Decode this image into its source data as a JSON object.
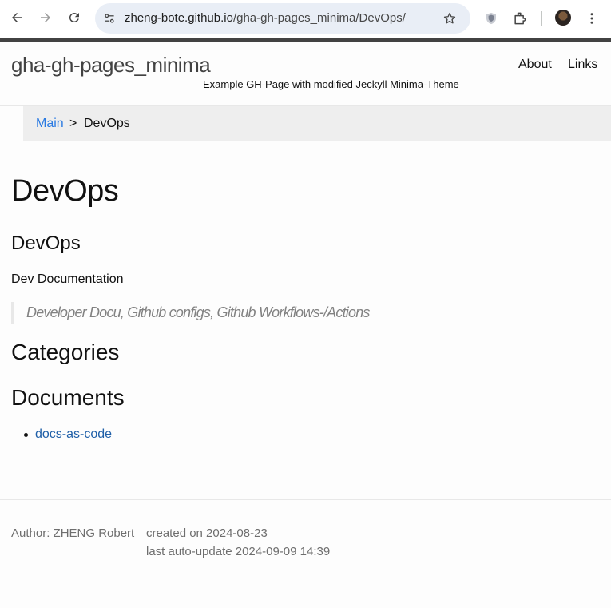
{
  "browser": {
    "url_host": "zheng-bote.github.io",
    "url_path": "/gha-gh-pages_minima/DevOps/",
    "icons": [
      "back-icon",
      "forward-icon",
      "reload-icon",
      "site-info-icon",
      "star-icon",
      "shield-extension-icon",
      "extensions-icon",
      "profile-avatar",
      "more-menu-icon"
    ]
  },
  "header": {
    "site_title": "gha-gh-pages_minima",
    "site_subtitle": "Example GH-Page with modified Jeckyll Minima-Theme",
    "nav": [
      "About",
      "Links"
    ]
  },
  "breadcrumb": {
    "link": "Main",
    "separator": ">",
    "current": "DevOps"
  },
  "main": {
    "title": "DevOps",
    "subtitle": "DevOps",
    "description": "Dev Documentation",
    "quote": "Developer Docu, Github configs, Github Workflows-/Actions",
    "categories_heading": "Categories",
    "documents_heading": "Documents",
    "documents": [
      "docs-as-code"
    ]
  },
  "footer": {
    "author": "Author: ZHENG Robert",
    "created": "created on 2024-08-23",
    "updated": "last auto-update 2024-09-09 14:39"
  },
  "colors": {
    "link": "#2a7ae2",
    "header_bar": "#424242",
    "breadcrumb_bg": "#eeeeee",
    "omnibox_bg": "#e9eef6"
  }
}
